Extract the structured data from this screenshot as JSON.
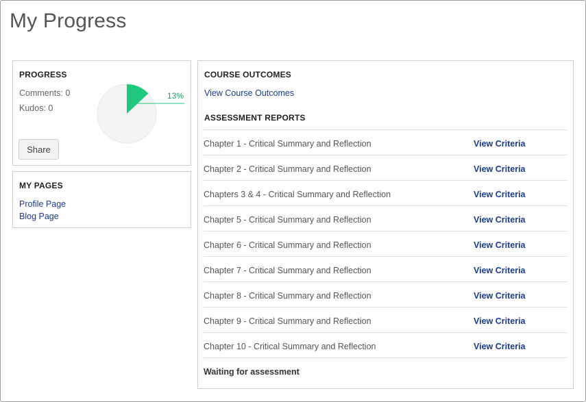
{
  "page": {
    "title": "My Progress"
  },
  "progress": {
    "heading": "PROGRESS",
    "comments_label": "Comments: 0",
    "kudos_label": "Kudos: 0",
    "percent_label": "13%",
    "percent_value": 13,
    "share_label": "Share",
    "colors": {
      "slice": "#1ec87c",
      "track": "#f4f4f4",
      "label": "#1aa569"
    }
  },
  "my_pages": {
    "heading": "MY PAGES",
    "links": [
      {
        "label": "Profile Page"
      },
      {
        "label": "Blog Page"
      }
    ]
  },
  "course_outcomes": {
    "heading": "COURSE OUTCOMES",
    "link_label": "View Course Outcomes"
  },
  "assessment_reports": {
    "heading": "ASSESSMENT REPORTS",
    "rows": [
      {
        "name": "Chapter 1 - Critical Summary and Reflection",
        "action": "View Criteria"
      },
      {
        "name": "Chapter 2 - Critical Summary and Reflection",
        "action": "View Criteria"
      },
      {
        "name": "Chapters 3 & 4 - Critical Summary and Reflection",
        "action": "View Criteria"
      },
      {
        "name": "Chapter 5 - Critical Summary and Reflection",
        "action": "View Criteria"
      },
      {
        "name": "Chapter 6 - Critical Summary and Reflection",
        "action": "View Criteria"
      },
      {
        "name": "Chapter 7 - Critical Summary and Reflection",
        "action": "View Criteria"
      },
      {
        "name": "Chapter 8 - Critical Summary and Reflection",
        "action": "View Criteria"
      },
      {
        "name": "Chapter 9 - Critical Summary and Reflection",
        "action": "View Criteria"
      },
      {
        "name": "Chapter 10 - Critical Summary and Reflection",
        "action": "View Criteria"
      }
    ],
    "footer": "Waiting for assessment"
  }
}
